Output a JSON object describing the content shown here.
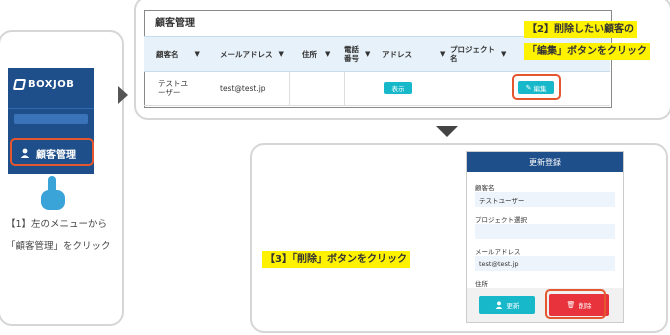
{
  "step1": {
    "logo_text": "BOXJOB",
    "menu_item_label": "顧客管理",
    "caption_line1": "【1】左のメニューから",
    "caption_line2": "「顧客管理」をクリック",
    "accent": "#e4572e",
    "sidebar_color": "#1f4f8a"
  },
  "table": {
    "title": "顧客管理",
    "headers": {
      "name": "顧客名",
      "email": "メールアドレス",
      "address_region": "住所",
      "phone": "電話\n番号",
      "address": "アドレス",
      "project": "プロジェクト\n名"
    },
    "row": {
      "name": "テストユ\nーザー",
      "email": "test@test.jp",
      "show_button": "表示",
      "edit_button": "編集"
    },
    "header_bg": "#e7f1f9",
    "button_color": "#17b8c9"
  },
  "step2": {
    "note_line1": "【2】削除したい顧客の",
    "note_line2": "「編集」ボタンをクリック"
  },
  "step3": {
    "note": "【3】「削除」ボタンをクリック"
  },
  "dialog": {
    "title": "更新登録",
    "fields": {
      "customer_name_label": "顧客名",
      "customer_name_value": "テストユーザー",
      "project_label": "プロジェクト選択",
      "project_value": "",
      "email_label": "メールアドレス",
      "email_value": "test@test.jp",
      "address_label": "住所"
    },
    "update_button": "更新",
    "delete_button": "削除",
    "delete_color": "#e8323c"
  },
  "icons": [
    "logo-mark-icon",
    "user-icon",
    "pointing-hand-icon",
    "sort-arrow-icon",
    "edit-icon",
    "trash-icon",
    "arrow-right-icon",
    "arrow-down-icon"
  ]
}
